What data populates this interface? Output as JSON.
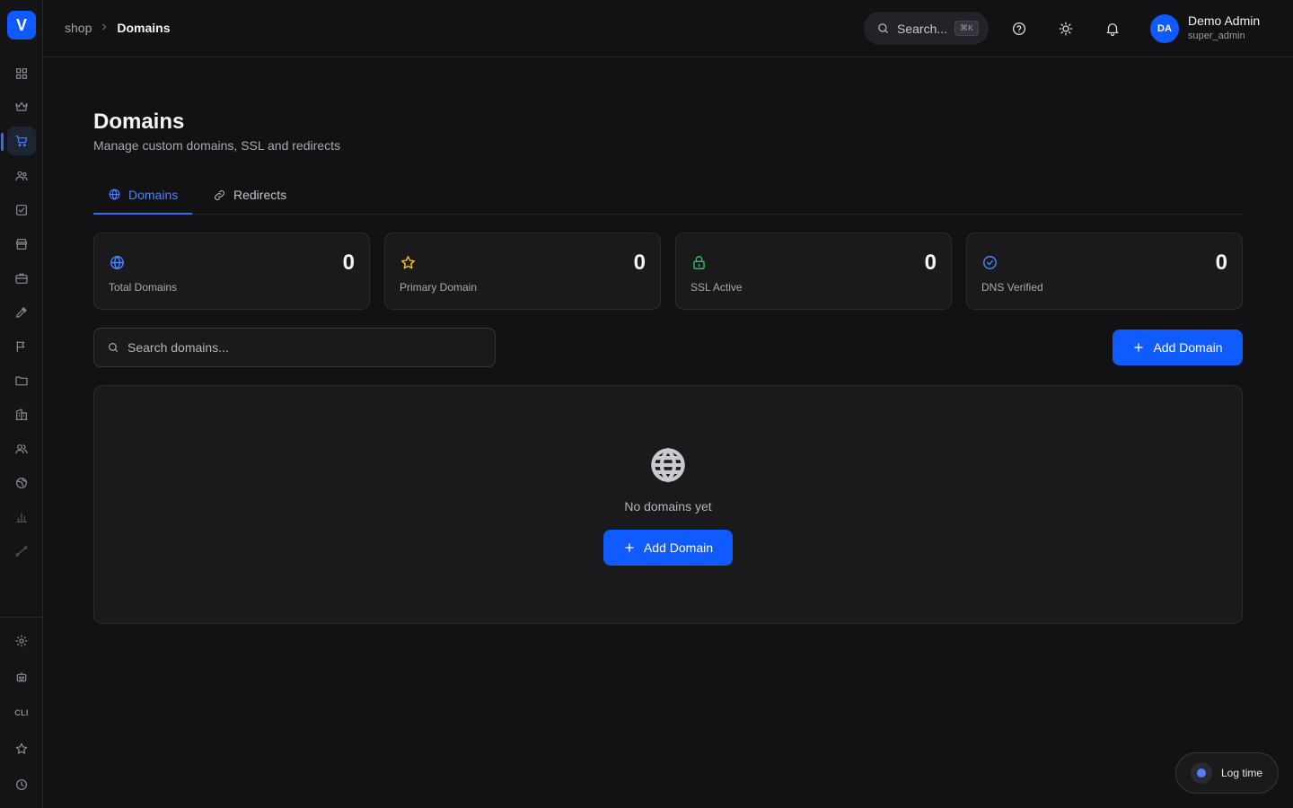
{
  "brand": {
    "logo_letter": "V"
  },
  "breadcrumb": {
    "root": "shop",
    "current": "Domains"
  },
  "header": {
    "search_label": "Search...",
    "search_shortcut": "⌘K",
    "user": {
      "initials": "DA",
      "name": "Demo Admin",
      "role": "super_admin"
    }
  },
  "sidebar": {
    "items": [
      {
        "icon": "grid-icon"
      },
      {
        "icon": "crown-icon"
      },
      {
        "icon": "cart-icon",
        "active": true
      },
      {
        "icon": "users-icon"
      },
      {
        "icon": "checkbox-icon"
      },
      {
        "icon": "store-icon"
      },
      {
        "icon": "briefcase-icon"
      },
      {
        "icon": "pen-icon"
      },
      {
        "icon": "megaphone-icon"
      },
      {
        "icon": "folder-icon"
      },
      {
        "icon": "building-icon"
      },
      {
        "icon": "team-icon"
      },
      {
        "icon": "globe-icon"
      },
      {
        "icon": "bar-chart-icon"
      },
      {
        "icon": "route-icon"
      }
    ],
    "bottom": {
      "cli_label": "CLI"
    }
  },
  "page": {
    "title": "Domains",
    "subtitle": "Manage custom domains, SSL and redirects"
  },
  "tabs": [
    {
      "label": "Domains",
      "active": true
    },
    {
      "label": "Redirects",
      "active": false
    }
  ],
  "stats": [
    {
      "label": "Total Domains",
      "value": "0",
      "icon": "globe-icon",
      "color": "#4d82ff"
    },
    {
      "label": "Primary Domain",
      "value": "0",
      "icon": "star-icon",
      "color": "#f5c518"
    },
    {
      "label": "SSL Active",
      "value": "0",
      "icon": "lock-icon",
      "color": "#2fbf5a"
    },
    {
      "label": "DNS Verified",
      "value": "0",
      "icon": "check-circle-icon",
      "color": "#4d82ff"
    }
  ],
  "search": {
    "placeholder": "Search domains..."
  },
  "actions": {
    "add_domain": "Add Domain"
  },
  "empty_state": {
    "message": "No domains yet",
    "cta": "Add Domain"
  },
  "floating": {
    "log_time": "Log time"
  },
  "colors": {
    "accent": "#0f5bff",
    "background": "#121215",
    "card": "#1a1a1d"
  }
}
